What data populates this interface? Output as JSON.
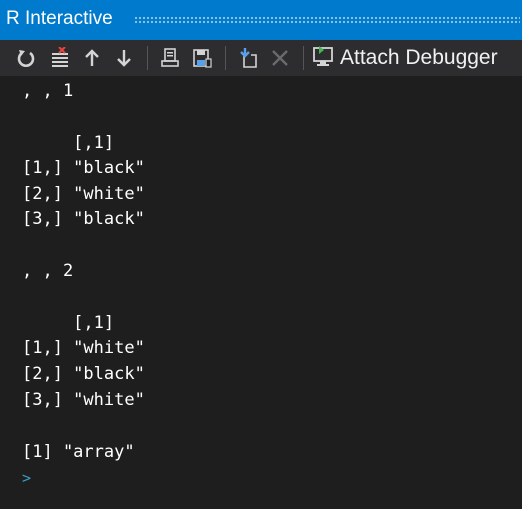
{
  "window": {
    "title": "R Interactive"
  },
  "toolbar": {
    "buttons": [
      {
        "icon": "reset-icon"
      },
      {
        "icon": "clear-console-icon"
      },
      {
        "icon": "history-up-icon"
      },
      {
        "icon": "history-down-icon"
      },
      {
        "icon": "load-workspace-icon"
      },
      {
        "icon": "save-workspace-icon"
      },
      {
        "icon": "set-working-directory-icon"
      },
      {
        "icon": "interrupt-icon"
      }
    ],
    "attach_debugger_label": "Attach Debugger"
  },
  "console": {
    "lines": [
      ", , 1",
      "",
      "     [,1]",
      "[1,] \"black\"",
      "[2,] \"white\"",
      "[3,] \"black\"",
      "",
      ", , 2",
      "",
      "     [,1]",
      "[1,] \"white\"",
      "[2,] \"black\"",
      "[3,] \"white\"",
      "",
      "[1] \"array\""
    ],
    "prompt": ">"
  },
  "colors": {
    "title_bar": "#007acc",
    "toolbar": "#2d2d30",
    "console_background": "#1e1e1e",
    "console_text": "#ffffff",
    "prompt": "#3a9fbf"
  }
}
